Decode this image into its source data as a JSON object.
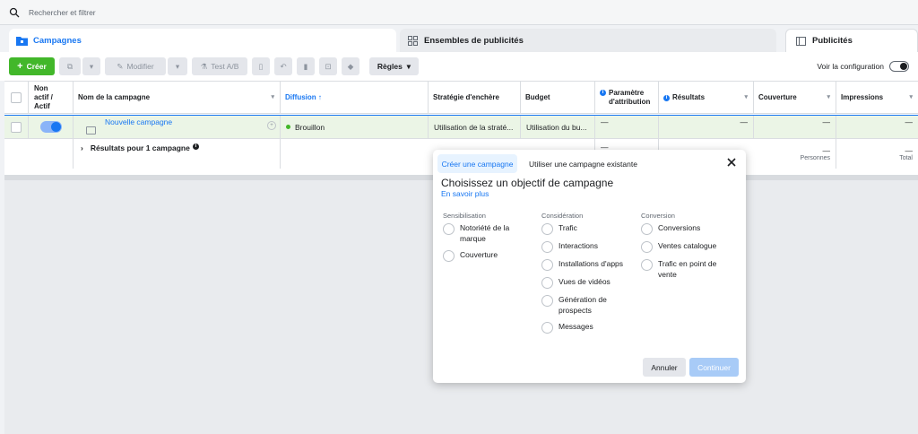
{
  "search": {
    "placeholder": "Rechercher et filtrer"
  },
  "tabs": [
    {
      "label": "Campagnes"
    },
    {
      "label": "Ensembles de publicités"
    },
    {
      "label": "Publicités"
    }
  ],
  "toolbar": {
    "create": "Créer",
    "edit": "Modifier",
    "ab_test": "Test A/B",
    "rules": "Règles",
    "config_label": "Voir la configuration"
  },
  "columns": {
    "onoff": "Non actif / Actif",
    "name": "Nom de la campagne",
    "delivery": "Diffusion ↑",
    "bid": "Stratégie d'enchère",
    "budget": "Budget",
    "attribution": "Paramètre d'attribution",
    "results": "Résultats",
    "reach": "Couverture",
    "impressions": "Impressions"
  },
  "row": {
    "name": "Nouvelle campagne",
    "delivery": "Brouillon",
    "bid": "Utilisation de la straté...",
    "budget": "Utilisation du bu...",
    "dash": "—"
  },
  "summary": {
    "label": "Résultats pour 1 campagne",
    "reach_sub": "Personnes",
    "impressions_sub": "Total",
    "dash": "—"
  },
  "modal": {
    "tab_create": "Créer une campagne",
    "tab_existing": "Utiliser une campagne existante",
    "title": "Choisissez un objectif de campagne",
    "learn_more": "En savoir plus",
    "columns": [
      {
        "heading": "Sensibilisation",
        "options": [
          "Notoriété de la marque",
          "Couverture"
        ]
      },
      {
        "heading": "Considération",
        "options": [
          "Trafic",
          "Interactions",
          "Installations d'apps",
          "Vues de vidéos",
          "Génération de prospects",
          "Messages"
        ]
      },
      {
        "heading": "Conversion",
        "options": [
          "Conversions",
          "Ventes catalogue",
          "Trafic en point de vente"
        ]
      }
    ],
    "cancel": "Annuler",
    "continue": "Continuer"
  }
}
